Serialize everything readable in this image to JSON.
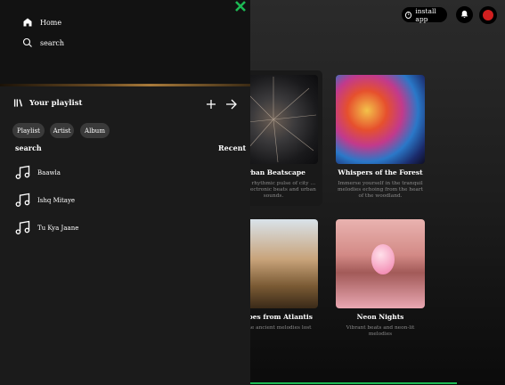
{
  "nav": {
    "home": "Home",
    "search": "search"
  },
  "library": {
    "title": "Your playlist",
    "filters": [
      "Playlist",
      "Artist",
      "Album"
    ],
    "search_label": "search",
    "sort_label": "Recent"
  },
  "songs": [
    {
      "title": "Baawla"
    },
    {
      "title": "Ishq Mitaye"
    },
    {
      "title": "Tu Kya Jaane"
    }
  ],
  "header": {
    "install_label": "install app"
  },
  "cards": [
    {
      "title": "Urban Beatscape",
      "desc": "…g the rhythmic pulse of city …ough electronic beats and urban sounds."
    },
    {
      "title": "Whispers of the Forest",
      "desc": "Immerse yourself in the tranquil melodies echoing from the heart of the woodland."
    },
    {
      "title": "Echoes from Atlantis",
      "desc": "…g the ancient melodies lost"
    },
    {
      "title": "Neon Nights",
      "desc": "Vibrant beats and neon-lit melodies"
    }
  ],
  "colors": {
    "accent": "#1db954",
    "close": "#1db954",
    "avatar": "#d11f1f"
  },
  "icons": [
    "home-icon",
    "search-icon",
    "library-icon",
    "plus-icon",
    "arrow-right-icon",
    "music-note-icon",
    "bell-icon",
    "download-icon",
    "close-icon"
  ]
}
